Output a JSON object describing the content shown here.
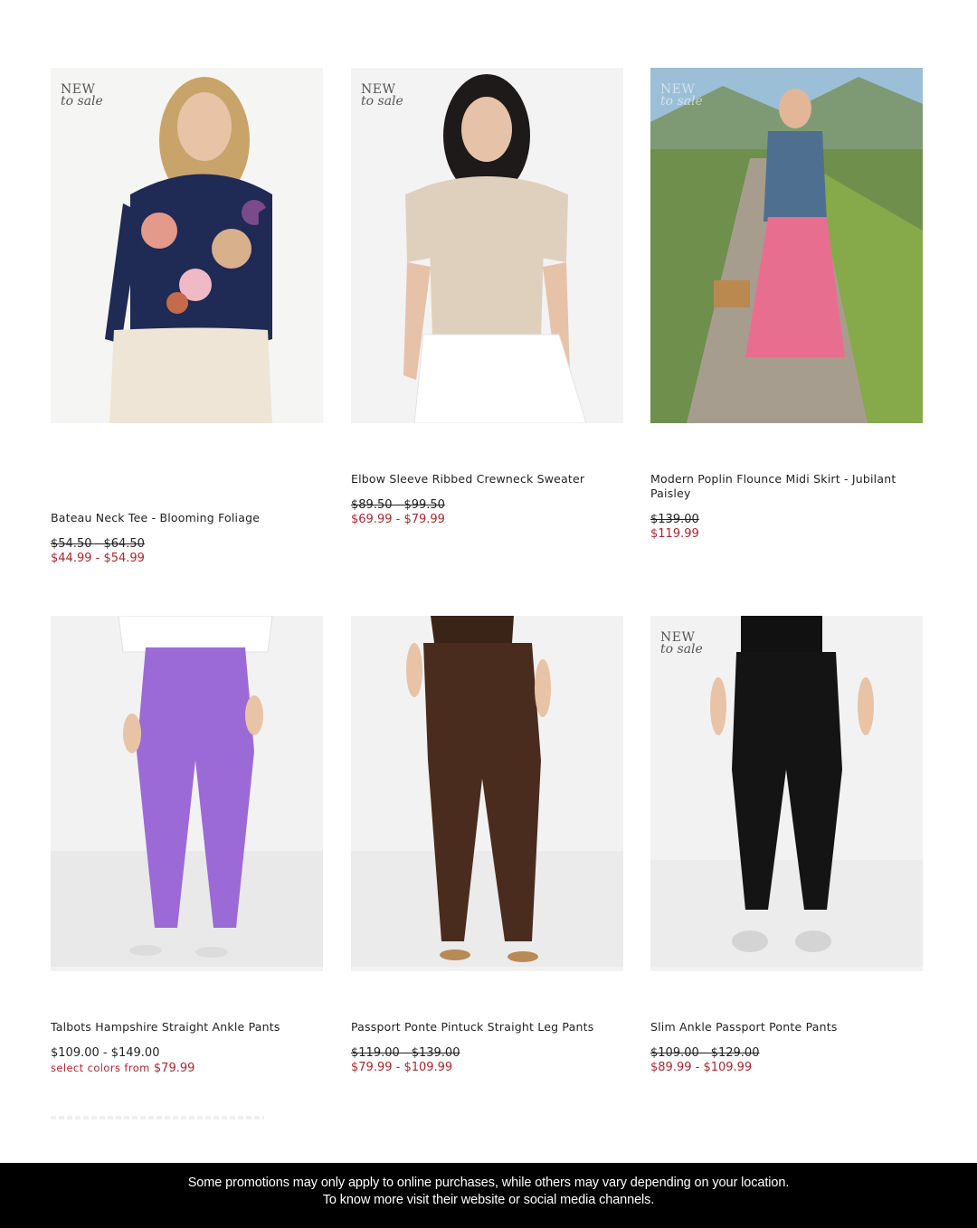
{
  "products": [
    {
      "badge": {
        "line1": "NEW",
        "line2": "to sale"
      },
      "name": "Bateau Neck Tee - Blooming Foliage",
      "original_price": "$54.50 - $64.50",
      "sale_price": "$44.99 - $54.99"
    },
    {
      "badge": {
        "line1": "NEW",
        "line2": "to sale"
      },
      "name": "Elbow Sleeve Ribbed Crewneck Sweater",
      "original_price": "$89.50 - $99.50",
      "sale_price": "$69.99 - $79.99"
    },
    {
      "badge": {
        "line1": "NEW",
        "line2": "to sale"
      },
      "name": "Modern Poplin Flounce Midi Skirt - Jubilant Paisley",
      "original_price": "$139.00",
      "sale_price": "$119.99"
    },
    {
      "name": "Talbots Hampshire Straight Ankle Pants",
      "original_price": "$109.00 - $149.00",
      "sale_prefix": "select colors from",
      "sale_price": "$79.99"
    },
    {
      "name": "Passport Ponte Pintuck Straight Leg Pants",
      "original_price": "$119.00 - $139.00",
      "sale_price": "$79.99 - $109.99"
    },
    {
      "badge": {
        "line1": "NEW",
        "line2": "to sale"
      },
      "name": "Slim Ankle Passport Ponte Pants",
      "original_price": "$109.00 - $129.00",
      "sale_price": "$89.99 - $109.99"
    }
  ],
  "footer": {
    "line1": "Some promotions may only apply to online purchases, while others may vary depending on your location.",
    "line2": "To know more visit their website or social media channels."
  },
  "colors": {
    "sale": "#b1252e",
    "footer_bg": "#000000"
  }
}
